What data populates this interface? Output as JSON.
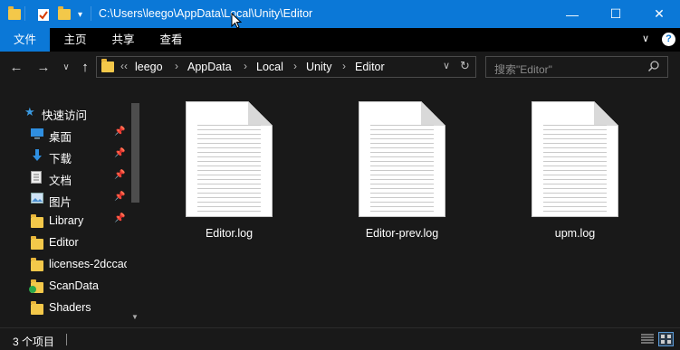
{
  "window": {
    "title_path": "C:\\Users\\leego\\AppData\\Local\\Unity\\Editor",
    "minimize": "—",
    "maximize": "☐",
    "close": "✕",
    "accent": "#0b78d7"
  },
  "ribbon": {
    "tabs": [
      {
        "label": "文件",
        "active": true
      },
      {
        "label": "主页"
      },
      {
        "label": "共享"
      },
      {
        "label": "查看"
      }
    ]
  },
  "nav": {
    "back": "←",
    "forward": "→",
    "recent": "∨",
    "up": "↑"
  },
  "address": {
    "overflow": "‹‹",
    "crumbs": [
      "leego",
      "AppData",
      "Local",
      "Unity",
      "Editor"
    ],
    "separator": "›"
  },
  "search": {
    "placeholder": "搜索\"Editor\""
  },
  "sidebar": {
    "items": [
      {
        "label": "快速访问",
        "icon": "star-icon"
      },
      {
        "label": "桌面",
        "icon": "desktop-icon",
        "pinned": true
      },
      {
        "label": "下载",
        "icon": "download-icon",
        "pinned": true
      },
      {
        "label": "文档",
        "icon": "document-icon",
        "pinned": true
      },
      {
        "label": "图片",
        "icon": "picture-icon",
        "pinned": true
      },
      {
        "label": "Library",
        "icon": "folder-icon",
        "pinned": true
      },
      {
        "label": "Editor",
        "icon": "folder-icon"
      },
      {
        "label": "licenses-2dccac",
        "icon": "folder-icon"
      },
      {
        "label": "ScanData",
        "icon": "folder-sync-icon"
      },
      {
        "label": "Shaders",
        "icon": "folder-icon"
      }
    ]
  },
  "files": [
    {
      "name": "Editor.log"
    },
    {
      "name": "Editor-prev.log"
    },
    {
      "name": "upm.log"
    }
  ],
  "status": {
    "count": "3 个项目"
  }
}
